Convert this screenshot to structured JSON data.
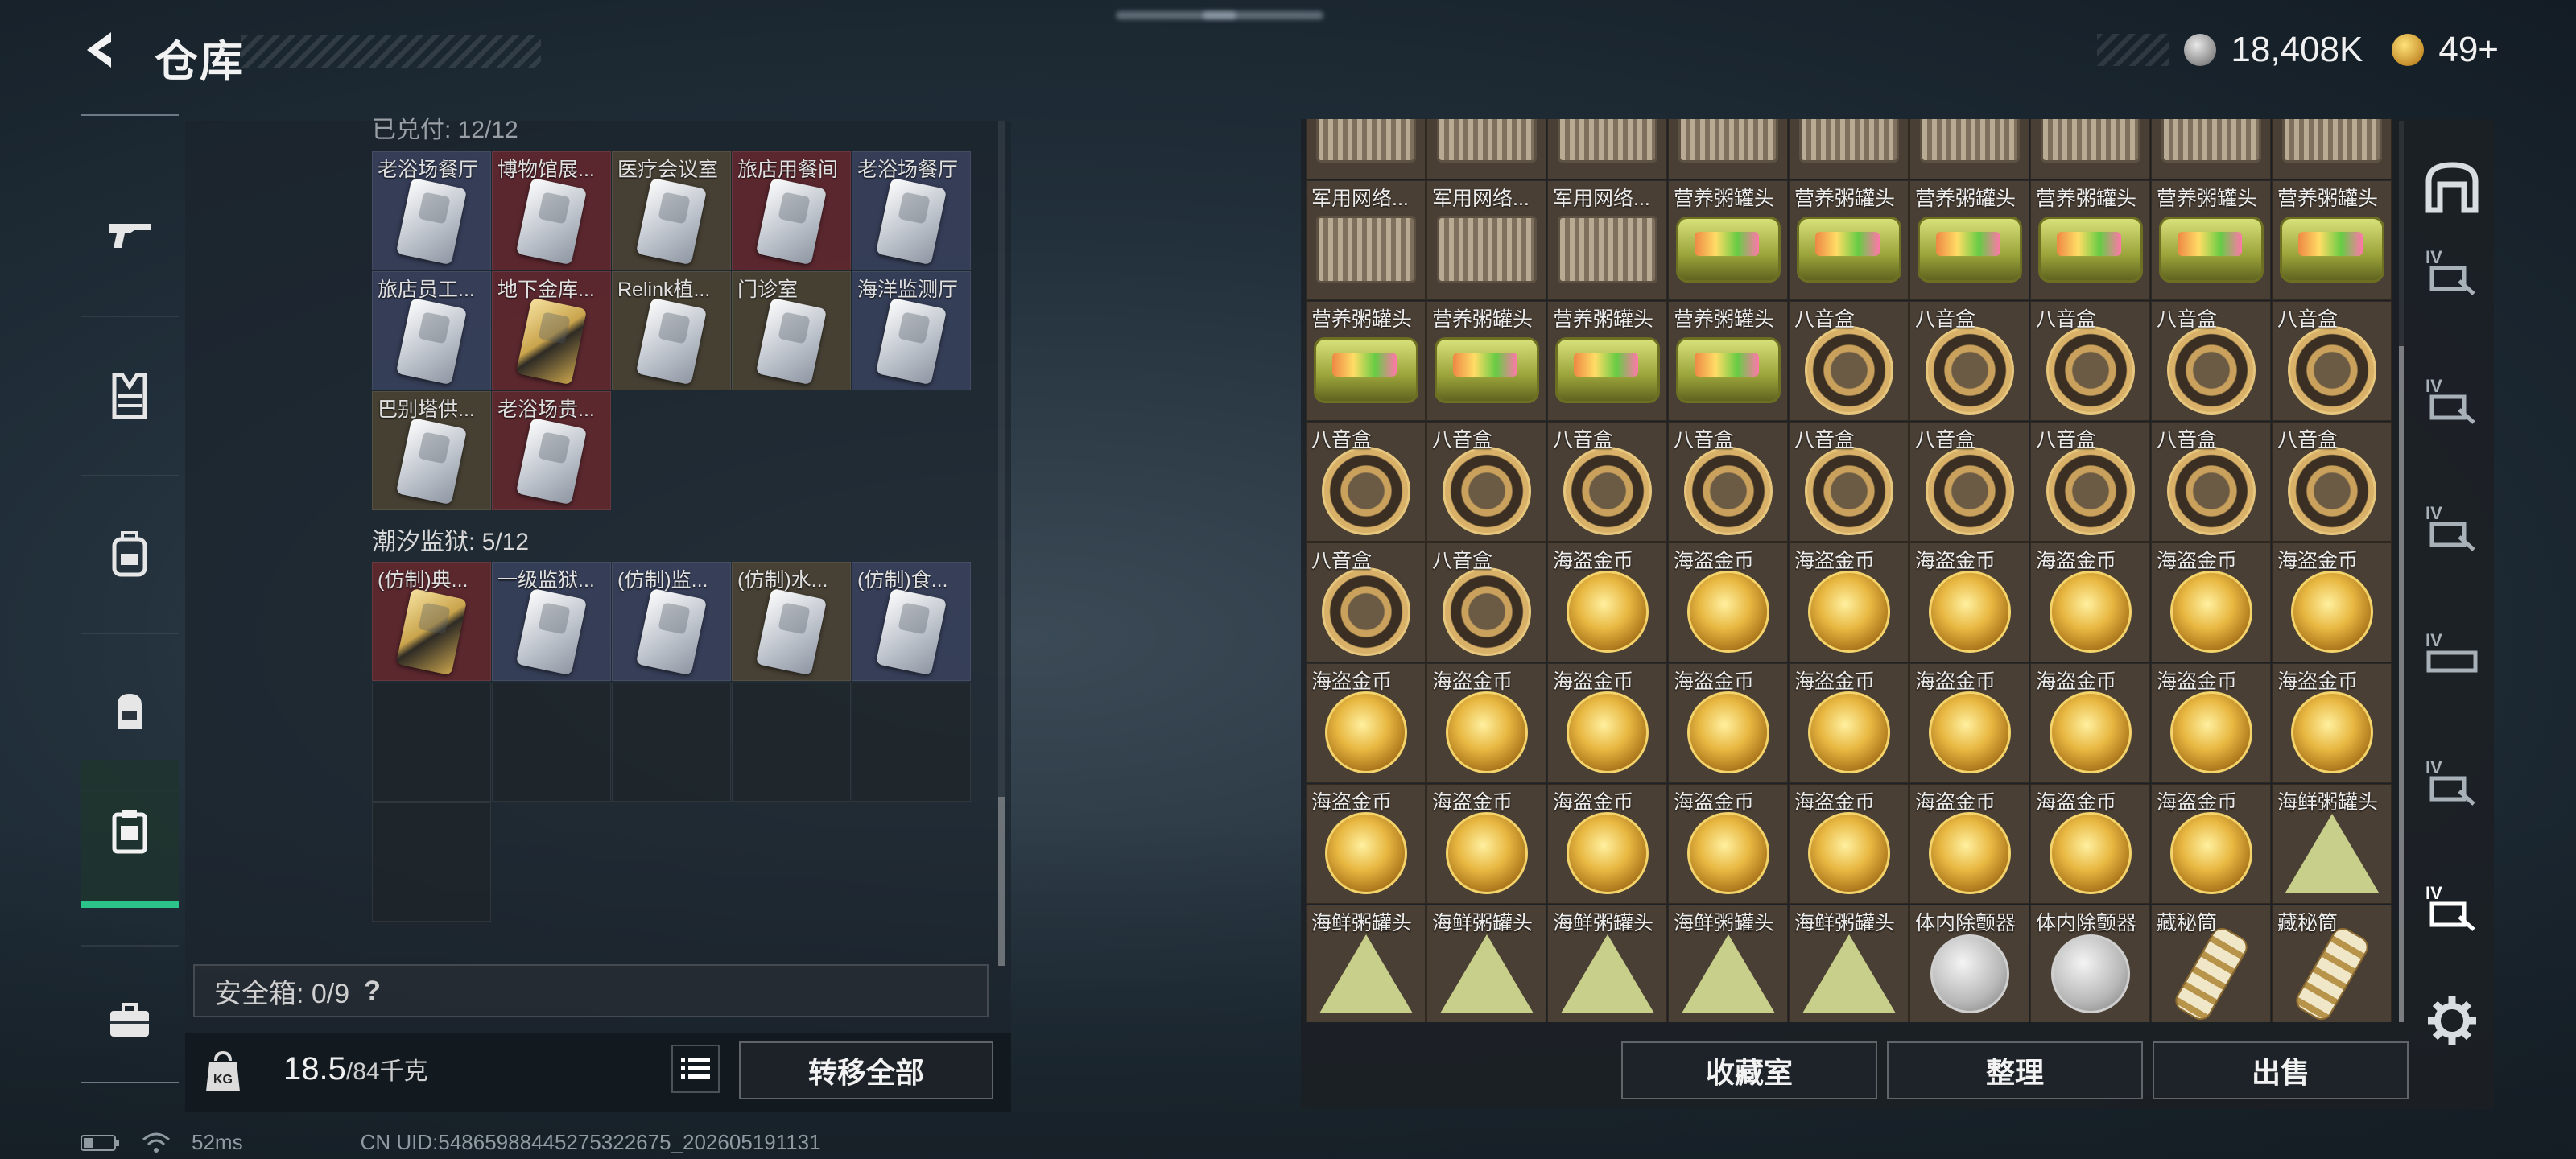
{
  "header": {
    "title": "仓库"
  },
  "currency": {
    "silver": "18,408K",
    "gold": "49+"
  },
  "left_nav": [
    "weapon",
    "armor",
    "backpack",
    "rig",
    "storage",
    "briefcase"
  ],
  "left_panel": {
    "section1_header": "已兑付: 12/12",
    "section1_items": [
      {
        "label": "老浴场餐厅",
        "style": "blue"
      },
      {
        "label": "博物馆展...",
        "style": "red"
      },
      {
        "label": "医疗会议室",
        "style": "brown"
      },
      {
        "label": "旅店用餐间",
        "style": "red"
      },
      {
        "label": "老浴场餐厅",
        "style": "blue"
      },
      {
        "label": "旅店员工...",
        "style": "blue"
      },
      {
        "label": "地下金库...",
        "style": "red",
        "gold": true
      },
      {
        "label": "Relink植...",
        "style": "brown"
      },
      {
        "label": "门诊室",
        "style": "brown"
      },
      {
        "label": "海洋监测厅",
        "style": "blue"
      },
      {
        "label": "巴别塔供...",
        "style": "brown"
      },
      {
        "label": "老浴场贵...",
        "style": "red"
      }
    ],
    "section2_header": "潮汐监狱: 5/12",
    "section2_items": [
      {
        "label": "(仿制)典...",
        "style": "red",
        "gold": true
      },
      {
        "label": "一级监狱...",
        "style": "blue"
      },
      {
        "label": "(仿制)监...",
        "style": "blue"
      },
      {
        "label": "(仿制)水...",
        "style": "brown"
      },
      {
        "label": "(仿制)食...",
        "style": "blue"
      }
    ],
    "safe_box": "安全箱: 0/9",
    "safe_box_help": "?",
    "weight_current": "18.5",
    "weight_max": "/84千克",
    "transfer_all": "转移全部"
  },
  "right_panel": {
    "items": [
      {
        "label": "",
        "icon": "crate"
      },
      {
        "label": "",
        "icon": "crate"
      },
      {
        "label": "",
        "icon": "crate"
      },
      {
        "label": "",
        "icon": "crate"
      },
      {
        "label": "",
        "icon": "crate"
      },
      {
        "label": "",
        "icon": "crate"
      },
      {
        "label": "",
        "icon": "crate"
      },
      {
        "label": "",
        "icon": "crate"
      },
      {
        "label": "",
        "icon": "crate"
      },
      {
        "label": "军用网络...",
        "icon": "crate"
      },
      {
        "label": "军用网络...",
        "icon": "crate"
      },
      {
        "label": "军用网络...",
        "icon": "crate"
      },
      {
        "label": "营养粥罐头",
        "icon": "tin"
      },
      {
        "label": "营养粥罐头",
        "icon": "tin"
      },
      {
        "label": "营养粥罐头",
        "icon": "tin"
      },
      {
        "label": "营养粥罐头",
        "icon": "tin"
      },
      {
        "label": "营养粥罐头",
        "icon": "tin"
      },
      {
        "label": "营养粥罐头",
        "icon": "tin"
      },
      {
        "label": "营养粥罐头",
        "icon": "tin"
      },
      {
        "label": "营养粥罐头",
        "icon": "tin"
      },
      {
        "label": "营养粥罐头",
        "icon": "tin"
      },
      {
        "label": "营养粥罐头",
        "icon": "tin"
      },
      {
        "label": "八音盒",
        "icon": "music"
      },
      {
        "label": "八音盒",
        "icon": "music"
      },
      {
        "label": "八音盒",
        "icon": "music"
      },
      {
        "label": "八音盒",
        "icon": "music"
      },
      {
        "label": "八音盒",
        "icon": "music"
      },
      {
        "label": "八音盒",
        "icon": "music"
      },
      {
        "label": "八音盒",
        "icon": "music"
      },
      {
        "label": "八音盒",
        "icon": "music"
      },
      {
        "label": "八音盒",
        "icon": "music"
      },
      {
        "label": "八音盒",
        "icon": "music"
      },
      {
        "label": "八音盒",
        "icon": "music"
      },
      {
        "label": "八音盒",
        "icon": "music"
      },
      {
        "label": "八音盒",
        "icon": "music"
      },
      {
        "label": "八音盒",
        "icon": "music"
      },
      {
        "label": "八音盒",
        "icon": "music"
      },
      {
        "label": "八音盒",
        "icon": "music"
      },
      {
        "label": "海盗金币",
        "icon": "coin"
      },
      {
        "label": "海盗金币",
        "icon": "coin"
      },
      {
        "label": "海盗金币",
        "icon": "coin"
      },
      {
        "label": "海盗金币",
        "icon": "coin"
      },
      {
        "label": "海盗金币",
        "icon": "coin"
      },
      {
        "label": "海盗金币",
        "icon": "coin"
      },
      {
        "label": "海盗金币",
        "icon": "coin"
      },
      {
        "label": "海盗金币",
        "icon": "coin"
      },
      {
        "label": "海盗金币",
        "icon": "coin"
      },
      {
        "label": "海盗金币",
        "icon": "coin"
      },
      {
        "label": "海盗金币",
        "icon": "coin"
      },
      {
        "label": "海盗金币",
        "icon": "coin"
      },
      {
        "label": "海盗金币",
        "icon": "coin"
      },
      {
        "label": "海盗金币",
        "icon": "coin"
      },
      {
        "label": "海盗金币",
        "icon": "coin"
      },
      {
        "label": "海盗金币",
        "icon": "coin"
      },
      {
        "label": "海盗金币",
        "icon": "coin"
      },
      {
        "label": "海盗金币",
        "icon": "coin"
      },
      {
        "label": "海盗金币",
        "icon": "coin"
      },
      {
        "label": "海盗金币",
        "icon": "coin"
      },
      {
        "label": "海盗金币",
        "icon": "coin"
      },
      {
        "label": "海盗金币",
        "icon": "coin"
      },
      {
        "label": "海盗金币",
        "icon": "coin"
      },
      {
        "label": "海盗金币",
        "icon": "coin"
      },
      {
        "label": "海鲜粥罐头",
        "icon": "tri"
      },
      {
        "label": "海鲜粥罐头",
        "icon": "tri"
      },
      {
        "label": "海鲜粥罐头",
        "icon": "tri"
      },
      {
        "label": "海鲜粥罐头",
        "icon": "tri"
      },
      {
        "label": "海鲜粥罐头",
        "icon": "tri"
      },
      {
        "label": "海鲜粥罐头",
        "icon": "tri"
      },
      {
        "label": "体内除颤器",
        "icon": "tag"
      },
      {
        "label": "体内除颤器",
        "icon": "tag"
      },
      {
        "label": "藏秘筒",
        "icon": "tube"
      },
      {
        "label": "藏秘筒",
        "icon": "tube"
      }
    ],
    "buttons": {
      "collection": "收藏室",
      "sort": "整理",
      "sell": "出售"
    }
  },
  "right_nav": [
    "room-icon",
    "tier-IV",
    "tier-IV",
    "tier-IV",
    "tier-IV",
    "tier-IV",
    "tier-IV"
  ],
  "status": {
    "ping": "52ms",
    "uid": "CN UID:5486598844527532267​5_202605191131"
  }
}
